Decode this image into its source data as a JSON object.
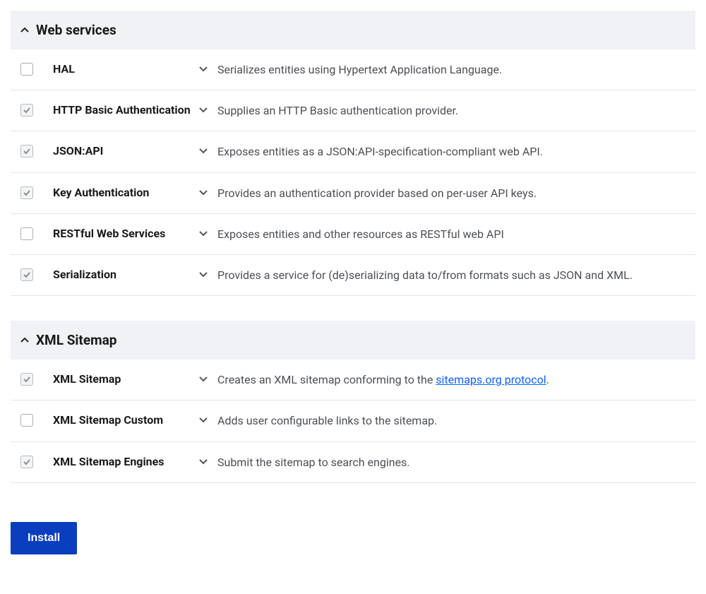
{
  "button_install": "Install",
  "sections": [
    {
      "title": "Web services",
      "rows": [
        {
          "name": "HAL",
          "desc": "Serializes entities using Hypertext Application Language.",
          "checked": false
        },
        {
          "name": "HTTP Basic Authentication",
          "desc": "Supplies an HTTP Basic authentication provider.",
          "checked": true
        },
        {
          "name": "JSON:API",
          "desc": "Exposes entities as a JSON:API-specification-compliant web API.",
          "checked": true
        },
        {
          "name": "Key Authentication",
          "desc": "Provides an authentication provider based on per-user API keys.",
          "checked": true
        },
        {
          "name": "RESTful Web Services",
          "desc": "Exposes entities and other resources as RESTful web API",
          "checked": false
        },
        {
          "name": "Serialization",
          "desc": "Provides a service for (de)serializing data to/from formats such as JSON and XML.",
          "checked": true
        }
      ]
    },
    {
      "title": "XML Sitemap",
      "rows": [
        {
          "name": "XML Sitemap",
          "desc": "Creates an XML sitemap conforming to the ",
          "link_text": "sitemaps.org protocol",
          "suffix": ".",
          "checked": true
        },
        {
          "name": "XML Sitemap Custom",
          "desc": "Adds user configurable links to the sitemap.",
          "checked": false
        },
        {
          "name": "XML Sitemap Engines",
          "desc": "Submit the sitemap to search engines.",
          "checked": true
        }
      ]
    }
  ]
}
